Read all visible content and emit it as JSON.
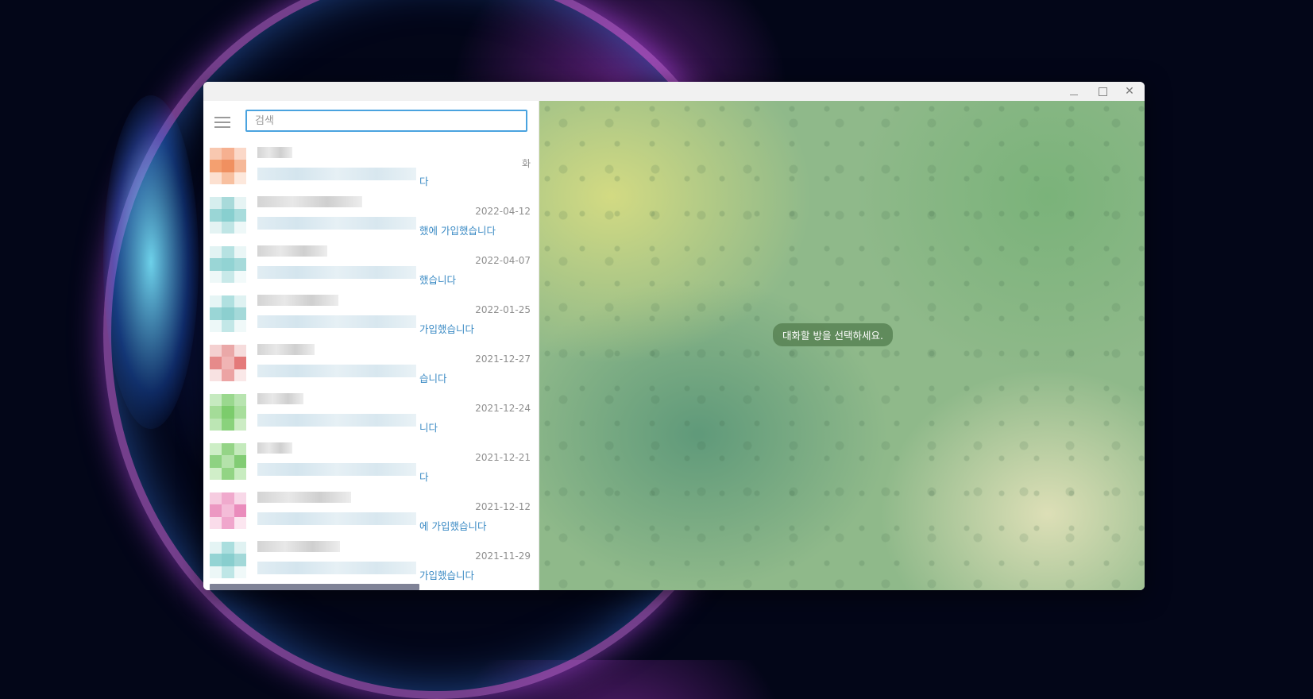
{
  "search": {
    "placeholder": "검색"
  },
  "chats": [
    {
      "date": "화",
      "snippet": "다",
      "avatar": [
        "#f8c8b0",
        "#f6b090",
        "#fbd8c8",
        "#f4a070",
        "#f09060",
        "#f6b898",
        "#fce0d0",
        "#f8c0a0",
        "#fde8dc"
      ],
      "name_w": 44
    },
    {
      "date": "2022-04-12",
      "snippet": "했에 가입했습니다",
      "avatar": [
        "#d6eeee",
        "#a8dada",
        "#e6f4f4",
        "#9ad6d6",
        "#88cfcf",
        "#a8dcdc",
        "#e4f3f3",
        "#bfe5e5",
        "#eef8f8"
      ],
      "name_w": 132
    },
    {
      "date": "2022-04-07",
      "snippet": "했습니다",
      "avatar": [
        "#e2f3f3",
        "#b6e2e2",
        "#eaf6f6",
        "#9ad6d6",
        "#92d3d3",
        "#a6dada",
        "#eef8f8",
        "#c8e9e9",
        "#f2fafa"
      ],
      "name_w": 88
    },
    {
      "date": "2022-01-25",
      "snippet": "가입했습니다",
      "avatar": [
        "#e6f5f5",
        "#b0e0e0",
        "#dff2f2",
        "#9ad6d6",
        "#8ccfcf",
        "#a4d9d9",
        "#edf8f8",
        "#c2e7e7",
        "#f0f9f9"
      ],
      "name_w": 102
    },
    {
      "date": "2021-12-27",
      "snippet": "습니다",
      "avatar": [
        "#f4d0d0",
        "#eaa8a8",
        "#f6dcdc",
        "#e68a8a",
        "#f0b4b4",
        "#e47a7a",
        "#f8e2e2",
        "#eca4a4",
        "#fae8e8"
      ],
      "name_w": 72
    },
    {
      "date": "2021-12-24",
      "snippet": "니다",
      "avatar": [
        "#c6eac0",
        "#9ad88e",
        "#b8e4b0",
        "#a4dc98",
        "#7ccc6c",
        "#a8de9c",
        "#bce6b4",
        "#8ad27c",
        "#ccecc4"
      ],
      "name_w": 58
    },
    {
      "date": "2021-12-21",
      "snippet": "다",
      "avatar": [
        "#cdeec6",
        "#94d486",
        "#c4eabc",
        "#8ed282",
        "#b4e2aa",
        "#82cc74",
        "#d0eec8",
        "#92d484",
        "#c8ecc0"
      ],
      "name_w": 44
    },
    {
      "date": "2021-12-12",
      "snippet": "에 가입했습니다",
      "avatar": [
        "#f6cce0",
        "#f0aacd",
        "#f8d8e8",
        "#ec98c2",
        "#f4bcd8",
        "#ea8cbc",
        "#fadcea",
        "#f0a6cc",
        "#fce6f0"
      ],
      "name_w": 118
    },
    {
      "date": "2021-11-29",
      "snippet": "가입했습니다",
      "avatar": [
        "#e4f4f4",
        "#aadede",
        "#e0f2f2",
        "#94d4d4",
        "#88cece",
        "#a2d8d8",
        "#ecf7f7",
        "#bee6e6",
        "#f0f9f9"
      ],
      "name_w": 104
    }
  ],
  "empty_state": {
    "message": "대화할 방을 선택하세요."
  }
}
